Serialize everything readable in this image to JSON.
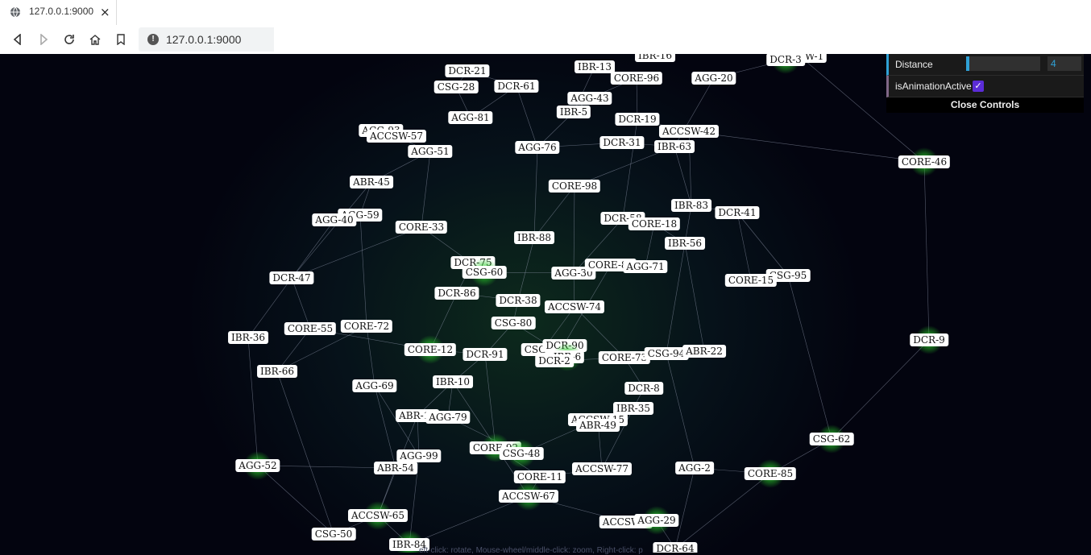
{
  "browser": {
    "tab_title": "127.0.0.1:9000",
    "close_glyph": "×",
    "url": "127.0.0.1:9000",
    "icons": [
      "globe-icon",
      "back-icon",
      "forward-icon",
      "reload-icon",
      "home-icon",
      "bookmark-icon",
      "info-icon"
    ]
  },
  "controls": {
    "distance_label": "Distance",
    "distance_value": "4",
    "distance_fraction": 0.04,
    "animation_label": "isAnimationActive",
    "animation_active": true,
    "close_label": "Close Controls"
  },
  "hint": "eft-click: rotate, Mouse-wheel/middle-click: zoom, Right-click: p",
  "colors": {
    "background": "#03040f",
    "node_glow": "#5dff5d",
    "link": "#9aa3b8",
    "slider": "#2fa1d6",
    "checkbox": "#5b2cd8"
  },
  "nodes": [
    {
      "id": "DCR-21"
    },
    {
      "id": "IBR-13"
    },
    {
      "id": "IBR-16"
    },
    {
      "id": "ACCSW-1"
    },
    {
      "id": "DCR-3"
    },
    {
      "id": "CSG-28"
    },
    {
      "id": "DCR-61"
    },
    {
      "id": "CORE-96"
    },
    {
      "id": "AGG-20"
    },
    {
      "id": "AGG-43"
    },
    {
      "id": "AGG-81"
    },
    {
      "id": "IBR-5"
    },
    {
      "id": "DCR-19"
    },
    {
      "id": "ACCSW-42"
    },
    {
      "id": "AGG-93"
    },
    {
      "id": "ACCSW-57"
    },
    {
      "id": "AGG-51"
    },
    {
      "id": "AGG-76"
    },
    {
      "id": "DCR-31"
    },
    {
      "id": "IBR-63"
    },
    {
      "id": "CORE-46"
    },
    {
      "id": "ABR-45"
    },
    {
      "id": "CORE-98"
    },
    {
      "id": "AGG-59"
    },
    {
      "id": "AGG-40"
    },
    {
      "id": "IBR-83"
    },
    {
      "id": "DCR-41"
    },
    {
      "id": "DCR-58"
    },
    {
      "id": "CORE-18"
    },
    {
      "id": "CORE-33"
    },
    {
      "id": "IBR-88"
    },
    {
      "id": "IBR-56"
    },
    {
      "id": "DCR-75"
    },
    {
      "id": "CSG-60"
    },
    {
      "id": "AGG-30"
    },
    {
      "id": "CORE-89"
    },
    {
      "id": "AGG-71"
    },
    {
      "id": "CSG-95"
    },
    {
      "id": "CORE-15"
    },
    {
      "id": "DCR-47"
    },
    {
      "id": "DCR-86"
    },
    {
      "id": "DCR-38"
    },
    {
      "id": "ACCSW-74"
    },
    {
      "id": "CSG-80"
    },
    {
      "id": "IBR-36"
    },
    {
      "id": "CORE-55"
    },
    {
      "id": "CORE-72"
    },
    {
      "id": "DCR-9"
    },
    {
      "id": "CORE-12"
    },
    {
      "id": "DCR-91"
    },
    {
      "id": "CSG-87"
    },
    {
      "id": "DCR-90"
    },
    {
      "id": "IBR-6"
    },
    {
      "id": "DCR-2"
    },
    {
      "id": "CORE-73"
    },
    {
      "id": "CSG-94"
    },
    {
      "id": "ABR-22"
    },
    {
      "id": "IBR-66"
    },
    {
      "id": "IBR-10"
    },
    {
      "id": "AGG-69"
    },
    {
      "id": "DCR-8"
    },
    {
      "id": "IBR-35"
    },
    {
      "id": "ABR-17"
    },
    {
      "id": "AGG-79"
    },
    {
      "id": "ACCSW-15"
    },
    {
      "id": "ABR-49"
    },
    {
      "id": "CSG-62"
    },
    {
      "id": "CORE-92"
    },
    {
      "id": "CSG-48"
    },
    {
      "id": "AGG-99"
    },
    {
      "id": "AGG-52"
    },
    {
      "id": "ABR-54"
    },
    {
      "id": "AGG-2"
    },
    {
      "id": "ACCSW-77"
    },
    {
      "id": "CORE-85"
    },
    {
      "id": "CORE-11"
    },
    {
      "id": "ACCSW-67"
    },
    {
      "id": "ACCSW-65"
    },
    {
      "id": "ACCSW-4"
    },
    {
      "id": "AGG-29"
    },
    {
      "id": "CSG-50"
    },
    {
      "id": "IBR-84"
    },
    {
      "id": "DCR-64"
    }
  ]
}
